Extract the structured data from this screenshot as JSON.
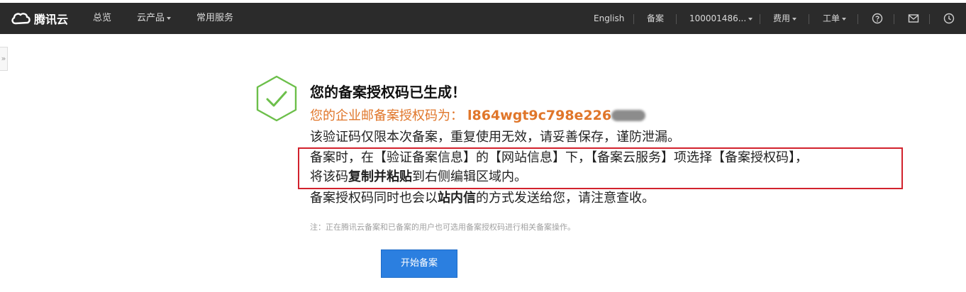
{
  "topbar": {
    "brand": "腾讯云",
    "nav": [
      {
        "label": "总览"
      },
      {
        "label": "云产品"
      },
      {
        "label": "常用服务"
      }
    ],
    "right": {
      "language": "English",
      "filing": "备案",
      "account": "100001486...",
      "billing": "费用",
      "ticket": "工单"
    },
    "icons": [
      "help-icon",
      "mail-icon",
      "clock-icon"
    ]
  },
  "main": {
    "title": "您的备案授权码已生成！",
    "code_label": "您的企业邮备案授权码为：",
    "code_value": "l864wgt9c798e226",
    "line1": "该验证码仅限本次备案，重复使用无效，请妥善保存，谨防泄漏。",
    "line2": "备案时，在【验证备案信息】的【网站信息】下，【备案云服务】项选择【备案授权码】，",
    "line3_prefix": "将该码",
    "line3_bold": "复制并粘贴",
    "line3_suffix": "到右侧编辑区域内。",
    "line4_prefix": "备案授权码同时也会以",
    "line4_bold": "站内信",
    "line4_suffix": "的方式发送给您，请注意查收。",
    "note": "注：正在腾讯云备案和已备案的用户也可选用备案授权码进行相关备案操作。",
    "start_button": "开始备案"
  },
  "colors": {
    "topbar_bg": "#2b2b2b",
    "success_green": "#6cbf4a",
    "code_orange": "#e0762a",
    "highlight_red": "#d2222d",
    "primary_blue": "#2b7fe0"
  }
}
